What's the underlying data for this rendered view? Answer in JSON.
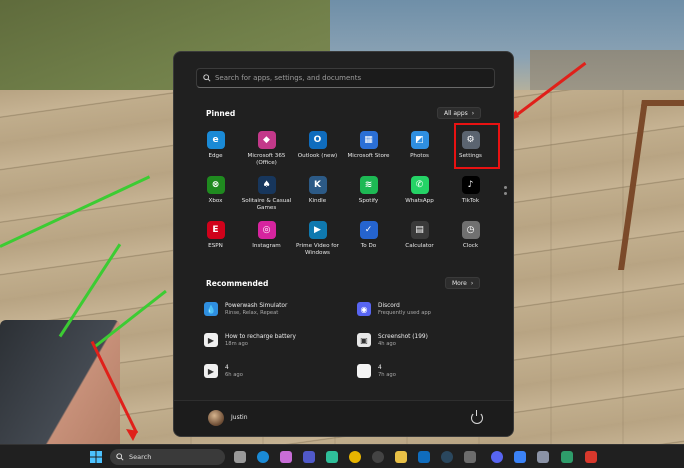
{
  "start_menu": {
    "search_placeholder": "Search for apps, settings, and documents",
    "pinned_title": "Pinned",
    "all_apps_label": "All apps",
    "pinned_apps": [
      {
        "name": "Edge",
        "icon": "edge-icon",
        "color": "#1a8ad6"
      },
      {
        "name": "Microsoft 365 (Office)",
        "icon": "office-icon",
        "color": "#c3398a"
      },
      {
        "name": "Outlook (new)",
        "icon": "outlook-icon",
        "color": "#0f6cbd"
      },
      {
        "name": "Microsoft Store",
        "icon": "store-icon",
        "color": "#2b6fd6"
      },
      {
        "name": "Photos",
        "icon": "photos-icon",
        "color": "#2f8fe0"
      },
      {
        "name": "Settings",
        "icon": "gear-icon",
        "color": "#5b6470"
      },
      {
        "name": "Xbox",
        "icon": "xbox-icon",
        "color": "#1f8a1f"
      },
      {
        "name": "Solitaire & Casual Games",
        "icon": "cards-icon",
        "color": "#17365c"
      },
      {
        "name": "Kindle",
        "icon": "kindle-icon",
        "color": "#2c5a86"
      },
      {
        "name": "Spotify",
        "icon": "spotify-icon",
        "color": "#1db954"
      },
      {
        "name": "WhatsApp",
        "icon": "whatsapp-icon",
        "color": "#25d366"
      },
      {
        "name": "TikTok",
        "icon": "tiktok-icon",
        "color": "#000000"
      },
      {
        "name": "ESPN",
        "icon": "espn-icon",
        "color": "#d0021b"
      },
      {
        "name": "Instagram",
        "icon": "instagram-icon",
        "color": "#d6249f"
      },
      {
        "name": "Prime Video for Windows",
        "icon": "prime-video-icon",
        "color": "#0f79af"
      },
      {
        "name": "To Do",
        "icon": "todo-icon",
        "color": "#2564cf"
      },
      {
        "name": "Calculator",
        "icon": "calculator-icon",
        "color": "#3a3a3a"
      },
      {
        "name": "Clock",
        "icon": "clock-icon",
        "color": "#707070"
      }
    ],
    "recommended_title": "Recommended",
    "more_label": "More",
    "recommended": [
      {
        "name": "Powerwash Simulator",
        "sub": "Rinse, Relax, Repeat",
        "icon": "powerwash-icon"
      },
      {
        "name": "Discord",
        "sub": "Frequently used app",
        "icon": "discord-icon"
      },
      {
        "name": "How to recharge battery",
        "sub": "18m ago",
        "icon": "video-file-icon"
      },
      {
        "name": "Screenshot (199)",
        "sub": "4h ago",
        "icon": "image-file-icon"
      },
      {
        "name": "4",
        "sub": "6h ago",
        "icon": "video-file-icon"
      },
      {
        "name": "4",
        "sub": "7h ago",
        "icon": "file-icon"
      }
    ],
    "user_name": "Justin"
  },
  "taskbar": {
    "search_label": "Search"
  },
  "colors": {
    "menu_bg": "#202020",
    "highlight": "#e81212",
    "annotation_line": "#3ccc33"
  }
}
